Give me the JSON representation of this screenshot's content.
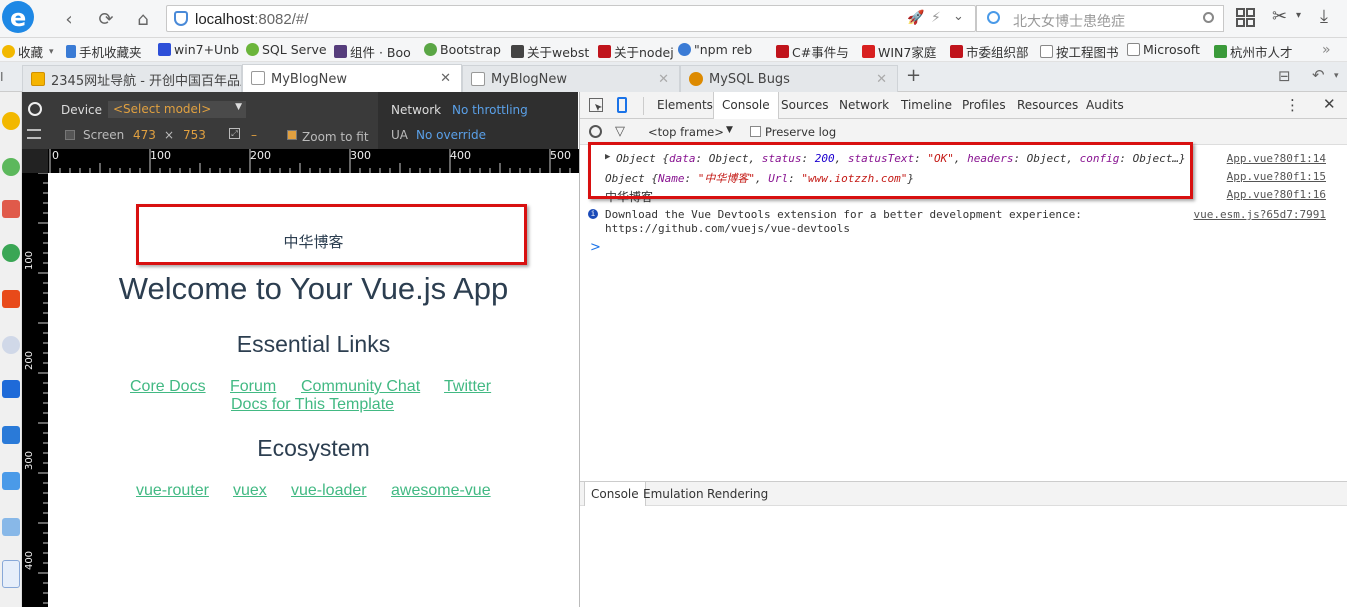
{
  "browser": {
    "url_host": "localhost",
    "url_rest": ":8082/#/",
    "search_placeholder": "北大女博士患绝症"
  },
  "bookmarks": [
    {
      "label": "收藏",
      "color": "#f2b800"
    },
    {
      "label": "手机收藏夹",
      "color": "#3a7bd5"
    },
    {
      "label": "win7+Unb",
      "color": "#2d4fd8"
    },
    {
      "label": "SQL Serve",
      "color": "#6bb53b"
    },
    {
      "label": "组件 · Boo",
      "color": "#563d7c"
    },
    {
      "label": "Bootstrap",
      "color": "#5aa645"
    },
    {
      "label": "关于webst",
      "color": "#444444"
    },
    {
      "label": "关于nodej",
      "color": "#c0141c"
    },
    {
      "label": "\"npm reb",
      "color": "#3a7bd5"
    },
    {
      "label": "C#事件与",
      "color": "#c0141c"
    },
    {
      "label": "WIN7家庭",
      "color": "#d82020"
    },
    {
      "label": "市委组织部",
      "color": "#c0141c"
    },
    {
      "label": "按工程图书",
      "color": "#888888"
    },
    {
      "label": "Microsoft",
      "color": "#888888"
    },
    {
      "label": "杭州市人才",
      "color": "#3a9a3a"
    }
  ],
  "tabs": [
    {
      "label": "2345网址导航 - 开创中国百年品牌"
    },
    {
      "label": "MyBlogNew"
    },
    {
      "label": "MyBlogNew"
    },
    {
      "label": "MySQL Bugs"
    }
  ],
  "emulation": {
    "device_label": "Device",
    "device_value": "<Select model>",
    "screen_label": "Screen",
    "width": "473",
    "times": "×",
    "height": "753",
    "dash": "–",
    "zoom_label": "Zoom to fit",
    "network_label": "Network",
    "network_value": "No throttling",
    "ua_label": "UA",
    "ua_value": "No override"
  },
  "ruler": {
    "h_ticks": [
      "0",
      "100",
      "200",
      "300",
      "400",
      "500"
    ],
    "v_ticks": [
      "100",
      "200",
      "300",
      "400"
    ]
  },
  "page": {
    "result_text": "中华博客",
    "title": "Welcome to Your Vue.js App",
    "essential_heading": "Essential Links",
    "essential_links": [
      "Core Docs",
      "Forum",
      "Community Chat",
      "Twitter",
      "Docs for This Template"
    ],
    "ecosystem_heading": "Ecosystem",
    "ecosystem_links": [
      "vue-router",
      "vuex",
      "vue-loader",
      "awesome-vue"
    ]
  },
  "devtools": {
    "tabs": [
      "Elements",
      "Console",
      "Sources",
      "Network",
      "Timeline",
      "Profiles",
      "Resources",
      "Audits"
    ],
    "active_tab": "Console",
    "frame": "<top frame>",
    "preserve_log": "Preserve log",
    "logs": [
      {
        "text": "Object {data: Object, status: 200, statusText: \"OK\", headers: Object, config: Object…}",
        "source": "App.vue?80f1:14"
      },
      {
        "text": "Object {Name: \"中华博客\", Url: \"www.iotzzh.com\"}",
        "source": "App.vue?80f1:15"
      },
      {
        "text": "中华博客",
        "source": "App.vue?80f1:16"
      },
      {
        "text": "Download the Vue Devtools extension for a better development experience:",
        "text2": "https://github.com/vuejs/vue-devtools",
        "source": "vue.esm.js?65d7:7991"
      }
    ],
    "prompt": ">",
    "drawer_tabs": [
      "Console",
      "Emulation",
      "Rendering"
    ]
  }
}
